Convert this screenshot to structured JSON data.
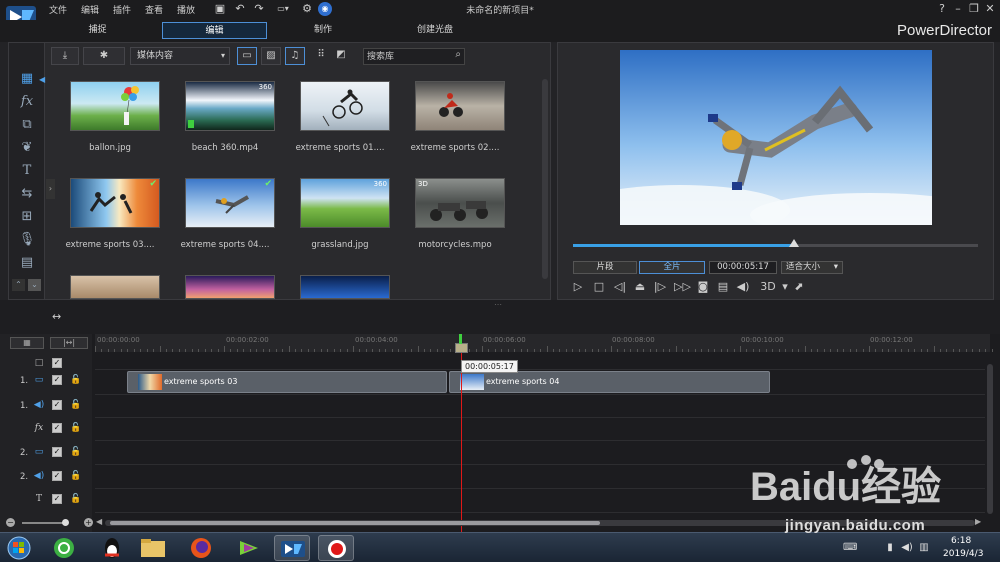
{
  "menubar": {
    "items": [
      "文件",
      "编辑",
      "插件",
      "查看",
      "播放"
    ],
    "title": "未命名的新项目*",
    "help": "?"
  },
  "modes": {
    "tabs": [
      "捕捉",
      "编辑",
      "制作",
      "创建光盘"
    ],
    "active": "编辑",
    "brand": "PowerDirector"
  },
  "library": {
    "media_select": "媒体内容",
    "search_placeholder": "搜索库",
    "items": [
      {
        "label": "ballon.jpg",
        "badge": "",
        "checked": false
      },
      {
        "label": "beach 360.mp4",
        "badge": "360",
        "checked": false
      },
      {
        "label": "extreme sports 01....",
        "badge": "",
        "checked": false
      },
      {
        "label": "extreme sports 02....",
        "badge": "",
        "checked": false
      },
      {
        "label": "extreme sports 03....",
        "badge": "",
        "checked": true
      },
      {
        "label": "extreme sports 04....",
        "badge": "",
        "checked": true
      },
      {
        "label": "grassland.jpg",
        "badge": "360",
        "checked": false
      },
      {
        "label": "motorcycles.mpo",
        "badge": "3D",
        "checked": false
      }
    ]
  },
  "preview": {
    "progress": 0.545,
    "clip_button": "片段",
    "full_button": "全片",
    "timecode": "00:00:05:17",
    "fit_select": "适合大小",
    "mode_3d": "3D"
  },
  "timeline": {
    "ruler_labels": [
      "00:00:00:00",
      "00:00:02:00",
      "00:00:04:00",
      "00:00:06:00",
      "00:00:08:00",
      "00:00:10:00",
      "00:00:12:00"
    ],
    "tooltip": "00:00:05:17",
    "tracks": [
      {
        "num": "1.",
        "type": "video"
      },
      {
        "num": "1.",
        "type": "audio"
      },
      {
        "num": "",
        "type": "fx"
      },
      {
        "num": "2.",
        "type": "video"
      },
      {
        "num": "2.",
        "type": "audio"
      },
      {
        "num": "",
        "type": "text"
      }
    ],
    "clips": [
      {
        "label": "extreme sports 03"
      },
      {
        "label": "extreme sports 04"
      }
    ]
  },
  "taskbar": {
    "time": "6:18",
    "date": "2019/4/3"
  },
  "watermark": {
    "brand": "Baidu经验",
    "domain": "jingyan.baidu.com"
  },
  "colors": {
    "accent": "#4d8fd6",
    "playhead": "#e01818",
    "progress": "#39a0e6"
  }
}
